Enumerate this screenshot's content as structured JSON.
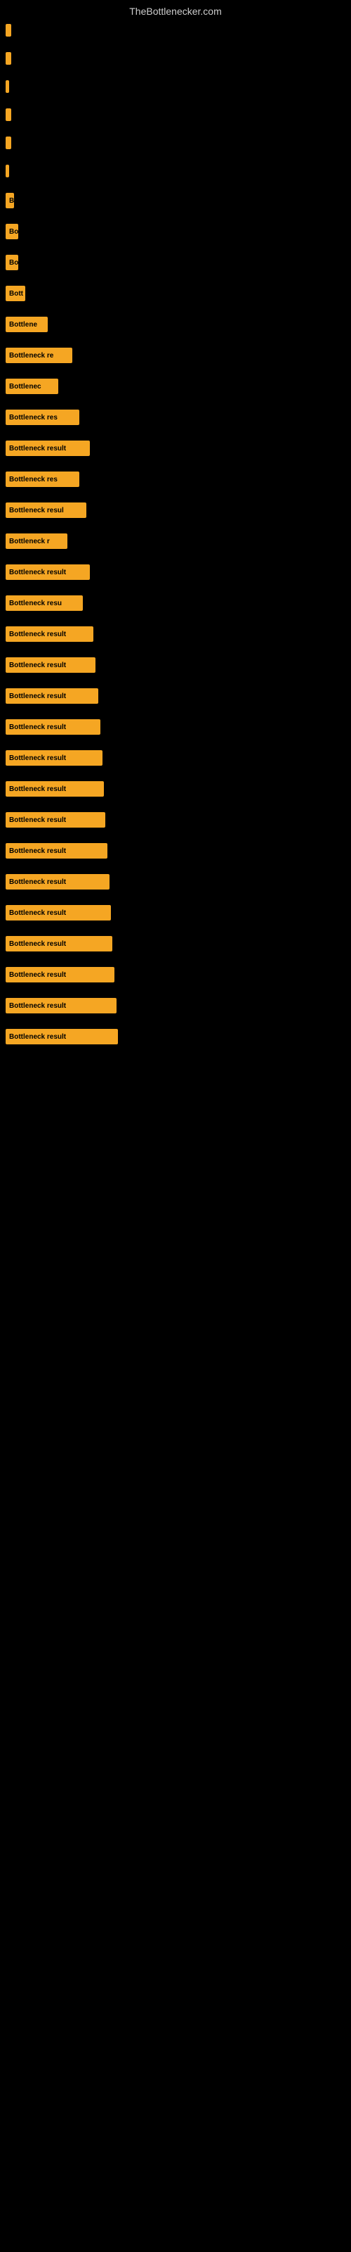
{
  "site": {
    "title": "TheBottlenecker.com"
  },
  "bars": [
    {
      "label": "",
      "width": 8
    },
    {
      "label": "",
      "width": 8
    },
    {
      "label": "",
      "width": 5
    },
    {
      "label": "",
      "width": 8
    },
    {
      "label": "",
      "width": 8
    },
    {
      "label": "",
      "width": 5
    },
    {
      "label": "B",
      "width": 12
    },
    {
      "label": "Bo",
      "width": 18
    },
    {
      "label": "Bo",
      "width": 18
    },
    {
      "label": "Bott",
      "width": 28
    },
    {
      "label": "Bottlene",
      "width": 60
    },
    {
      "label": "Bottleneck re",
      "width": 95
    },
    {
      "label": "Bottlenec",
      "width": 75
    },
    {
      "label": "Bottleneck res",
      "width": 105
    },
    {
      "label": "Bottleneck result",
      "width": 120
    },
    {
      "label": "Bottleneck res",
      "width": 105
    },
    {
      "label": "Bottleneck resul",
      "width": 115
    },
    {
      "label": "Bottleneck r",
      "width": 88
    },
    {
      "label": "Bottleneck result",
      "width": 120
    },
    {
      "label": "Bottleneck resu",
      "width": 110
    },
    {
      "label": "Bottleneck result",
      "width": 125
    },
    {
      "label": "Bottleneck result",
      "width": 128
    },
    {
      "label": "Bottleneck result",
      "width": 132
    },
    {
      "label": "Bottleneck result",
      "width": 135
    },
    {
      "label": "Bottleneck result",
      "width": 138
    },
    {
      "label": "Bottleneck result",
      "width": 140
    },
    {
      "label": "Bottleneck result",
      "width": 142
    },
    {
      "label": "Bottleneck result",
      "width": 145
    },
    {
      "label": "Bottleneck result",
      "width": 148
    },
    {
      "label": "Bottleneck result",
      "width": 150
    },
    {
      "label": "Bottleneck result",
      "width": 152
    },
    {
      "label": "Bottleneck result",
      "width": 155
    },
    {
      "label": "Bottleneck result",
      "width": 158
    },
    {
      "label": "Bottleneck result",
      "width": 160
    }
  ]
}
